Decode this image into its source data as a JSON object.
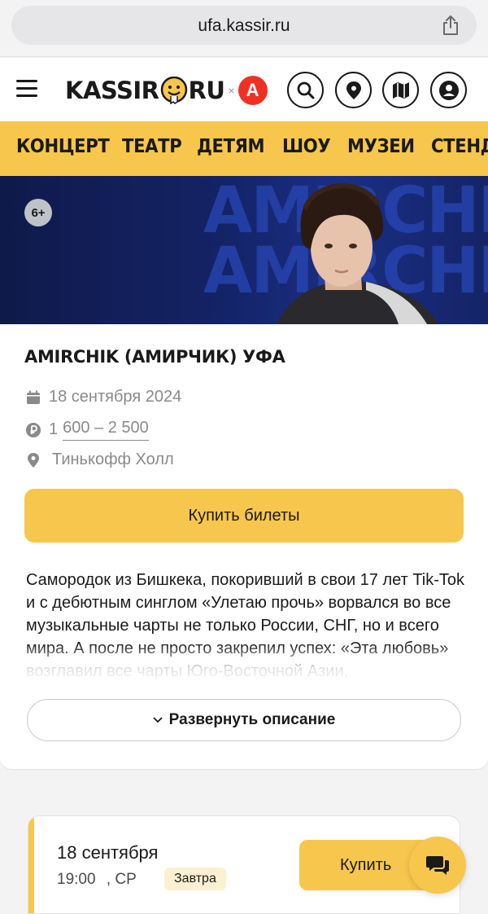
{
  "browser": {
    "url": "ufa.kassir.ru",
    "share_icon": "share-icon"
  },
  "header": {
    "menu_icon": "hamburger-icon",
    "logo_left": "KASSIR",
    "logo_right": "RU",
    "logo_separator": "×",
    "partner_letter": "А",
    "icons": [
      "search-icon",
      "location-pin-icon",
      "map-icon",
      "user-icon"
    ]
  },
  "categories": [
    "КОНЦЕРТ",
    "ТЕАТР",
    "ДЕТЯМ",
    "ШОУ",
    "МУЗЕИ",
    "СТЕНД"
  ],
  "event": {
    "banner_text": "AMIRCHIK",
    "age_rating": "6+",
    "title": "AMIRCHIK (АМИРЧИК) УФА",
    "date": "18 сентября 2024",
    "price_prefix": "1",
    "price_range": "600 – 2 500",
    "venue": "Тинькофф Холл",
    "buy_label": "Купить билеты",
    "description": "Самородок из Бишкека, покоривший в свои 17 лет Tik-Tok и с дебютным синглом «Улетаю прочь» ворвался во все музыкальные чарты не только России, СНГ, но и всего мира. А после не просто закрепил успех: «Эта любовь» возглавил все чарты Юго-Восточной Азии,",
    "expand_label": "Развернуть описание"
  },
  "session": {
    "date": "18 сентября",
    "time": "19:00",
    "weekday": ", СР",
    "badge": "Завтра",
    "buy_label": "Купить"
  },
  "colors": {
    "accent": "#f7c64c",
    "alfa_red": "#ef3124",
    "banner_blue": "#142366"
  }
}
